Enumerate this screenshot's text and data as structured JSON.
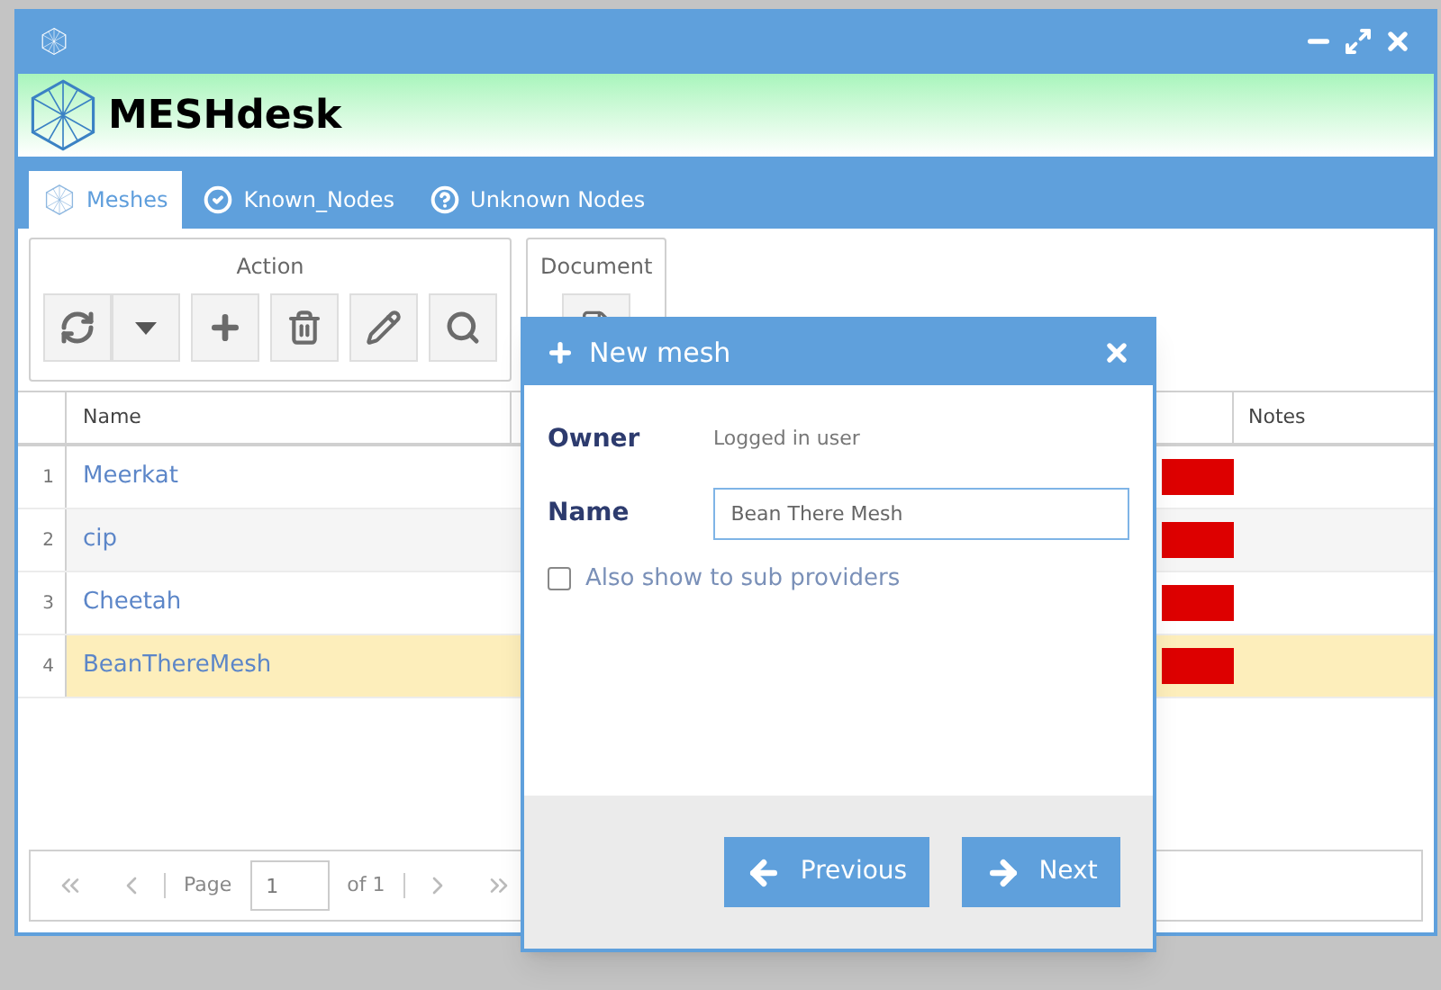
{
  "app": {
    "brand": "MESHdesk"
  },
  "tabs": [
    {
      "label": "Meshes",
      "selected": true
    },
    {
      "label": "Known_Nodes",
      "selected": false
    },
    {
      "label": "Unknown Nodes",
      "selected": false
    }
  ],
  "toolbar": {
    "groups": [
      {
        "title": "Action"
      },
      {
        "title": "Document"
      }
    ]
  },
  "table": {
    "columns": [
      "Name",
      "Notes"
    ],
    "rows": [
      {
        "number": "1",
        "name": "Meerkat",
        "color": "#dd0000",
        "selected": false
      },
      {
        "number": "2",
        "name": "cip",
        "color": "#dd0000",
        "selected": false
      },
      {
        "number": "3",
        "name": "Cheetah",
        "color": "#dd0000",
        "selected": false
      },
      {
        "number": "4",
        "name": "BeanThereMesh",
        "color": "#dd0000",
        "selected": true
      }
    ]
  },
  "pager": {
    "page_label": "Page",
    "page": "1",
    "of_label": "of 1"
  },
  "dialog": {
    "title": "New mesh",
    "owner_label": "Owner",
    "owner_value": "Logged in user",
    "name_label": "Name",
    "name_value": "Bean There Mesh",
    "checkbox": {
      "label": "Also show to sub providers",
      "checked": false
    },
    "buttons": [
      {
        "label": "Previous",
        "kind": "previous"
      },
      {
        "label": "Next",
        "kind": "next"
      }
    ]
  }
}
